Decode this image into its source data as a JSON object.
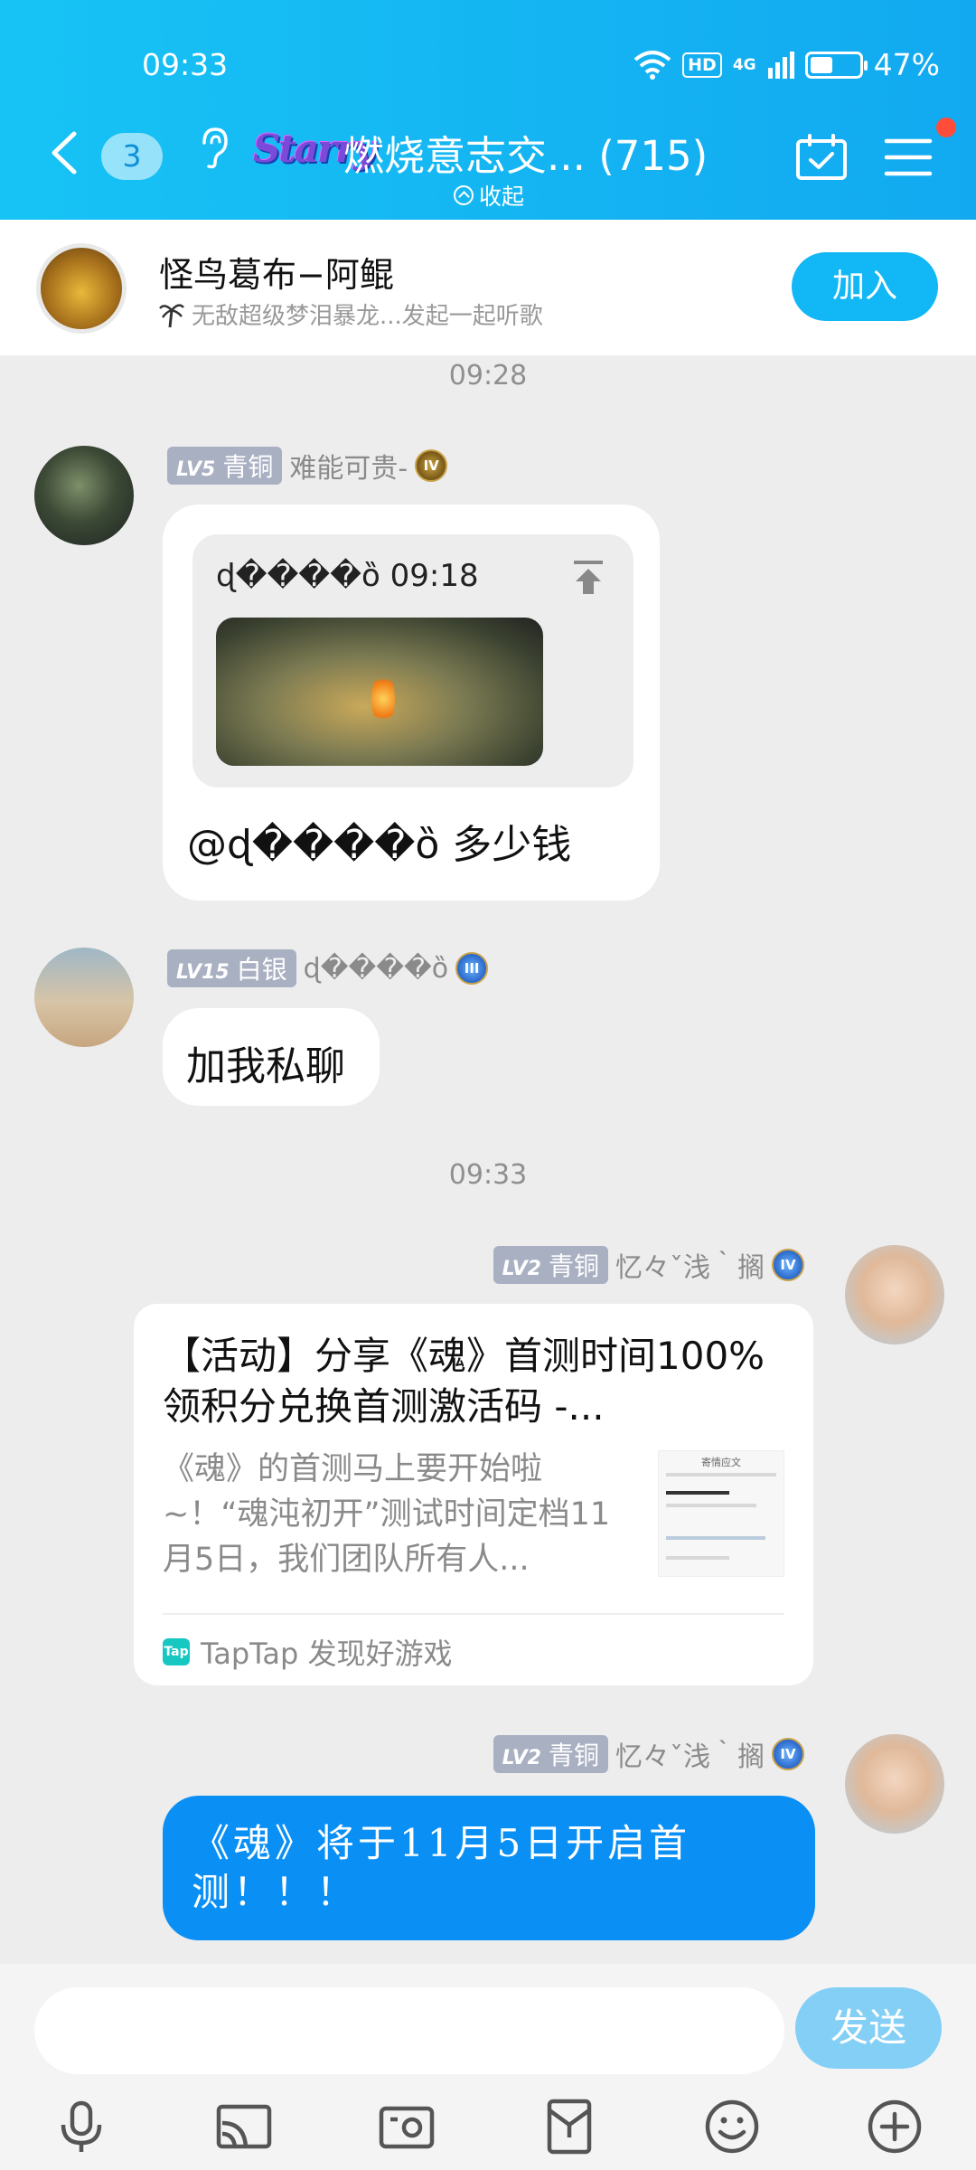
{
  "status_bar": {
    "time": "09:33",
    "hd": "HD",
    "network": "4G",
    "battery": "47%",
    "battery_level": 0.47
  },
  "header": {
    "unread_count": "3",
    "group_logo_text": "Starry",
    "group_title": "燃烧意志交... (715)",
    "collapse_label": "收起"
  },
  "banner": {
    "name": "怪鸟葛布−阿鲲",
    "subtitle": "无敌超级梦泪暴龙...发起一起听歌",
    "join_label": "加入"
  },
  "messages": {
    "ts1": "09:28",
    "m1": {
      "level_num": "LV5",
      "level_name": "青铜",
      "sender": "难能可贵-",
      "quote_name": "ɖ����ȍ 09:18",
      "text": "@ɖ����ȍ 多少钱"
    },
    "m2": {
      "level_num": "LV15",
      "level_name": "白银",
      "sender": "ɖ����ȍ",
      "text": "加我私聊"
    },
    "ts2": "09:33",
    "m3": {
      "level_num": "LV2",
      "level_name": "青铜",
      "sender": "忆々ˇ浅｀搁",
      "card_title": "【活动】分享《魂》首测时间100%领积分兑换首测激活码 -...",
      "card_desc": "《魂》的首测马上要开始啦~！“魂沌初开”测试时间定档11月5日，我们团队所有人...",
      "card_source": "TapTap 发现好游戏",
      "thumb_heading": "寄情应文"
    },
    "m4": {
      "level_num": "LV2",
      "level_name": "青铜",
      "sender": "忆々ˇ浅｀搁",
      "text": "《魂》将于11月5日开启首测！！！"
    }
  },
  "input": {
    "placeholder": "",
    "send_label": "发送"
  },
  "toolbar": [
    "mic-icon",
    "cast-icon",
    "photo-icon",
    "red-packet-icon",
    "emoji-icon",
    "plus-icon"
  ],
  "colors": {
    "header": "#12b7f5",
    "mine_bubble": "#0a8ff5",
    "send_disabled": "#84cff6"
  }
}
